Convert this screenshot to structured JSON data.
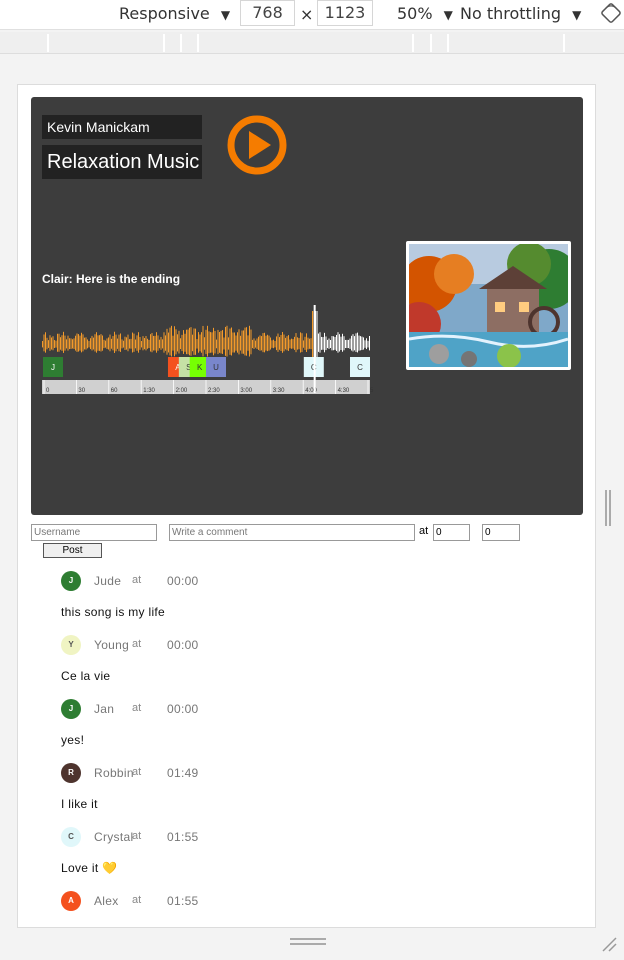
{
  "devtools": {
    "device": "Responsive",
    "width": "768",
    "height": "1123",
    "times": "×",
    "zoom": "50%",
    "throttling": "No throttling",
    "dropdown_glyph": "▼"
  },
  "player": {
    "artist": "Kevin Manickam",
    "track": "Relaxation Music",
    "caption": "Clair: Here is the ending",
    "progress_seconds": 250,
    "timeline_ticks": [
      "0",
      "30",
      "60",
      "1:30",
      "2:00",
      "2:30",
      "3:00",
      "3:30",
      "4:00",
      "4:30",
      "5"
    ],
    "comment_markers": [
      {
        "letter": "J",
        "time": "0:00",
        "color": "#2e7d32"
      },
      {
        "letter": "A",
        "time": "1:55",
        "color": "#f4511e"
      },
      {
        "letter": "S",
        "time": "2:05",
        "color": "#c5e1a5"
      },
      {
        "letter": "K",
        "time": "2:15",
        "color": "#76ff03"
      },
      {
        "letter": "U",
        "time": "2:30",
        "color": "#7986cb"
      },
      {
        "letter": "C",
        "time": "4:00",
        "color": "#e0f7fa"
      },
      {
        "letter": "C",
        "time": "5:00",
        "color": "#e0f7fa"
      }
    ],
    "wave_color_played": "#f39a2b",
    "wave_color_remaining": "#ffffff",
    "accent": "#f57c00"
  },
  "form": {
    "username_placeholder": "Username",
    "comment_placeholder": "Write a comment",
    "at_label": "at",
    "minutes_value": "0",
    "seconds_value": "0",
    "colon": ":",
    "post_label": "Post"
  },
  "comments": [
    {
      "initial": "J",
      "name": "Jude",
      "at": "at",
      "time": "00:00",
      "text": "this song is my life",
      "color": "#2e7d32",
      "fg": "#ffffff"
    },
    {
      "initial": "Y",
      "name": "Young",
      "at": "at",
      "time": "00:00",
      "text": "Ce la vie",
      "color": "#f0f4c3",
      "fg": "#555555"
    },
    {
      "initial": "J",
      "name": "Jan",
      "at": "at",
      "time": "00:00",
      "text": "yes!",
      "color": "#2e7d32",
      "fg": "#ffffff"
    },
    {
      "initial": "R",
      "name": "Robbin",
      "at": "at",
      "time": "01:49",
      "text": "I like it",
      "color": "#4e342e",
      "fg": "#ffffff"
    },
    {
      "initial": "C",
      "name": "Crystal",
      "at": "at",
      "time": "01:55",
      "text": "Love it 💛",
      "color": "#e0f7fa",
      "fg": "#555555"
    },
    {
      "initial": "A",
      "name": "Alex",
      "at": "at",
      "time": "01:55",
      "text": "",
      "color": "#f4511e",
      "fg": "#ffffff"
    }
  ]
}
